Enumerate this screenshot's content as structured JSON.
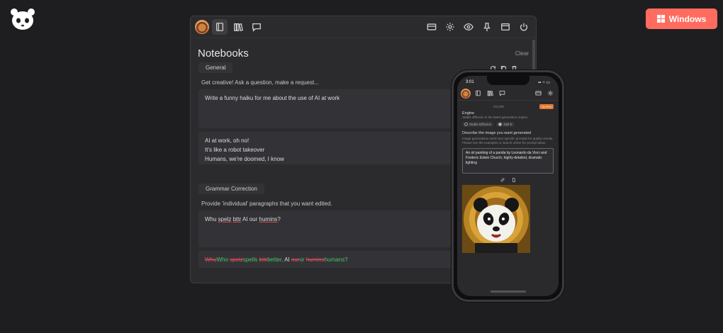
{
  "site": {
    "download_button_label": "Windows"
  },
  "app": {
    "notebooks_title": "Notebooks",
    "clear_label": "Clear",
    "cells": [
      {
        "tab": "General",
        "prompt_hint": "Get creative! Ask a question, make a request...",
        "input": "Write a funny haiku for me about the use of AI at work",
        "output_lines": [
          "AI at work, oh no!",
          "It's like a robot takeover",
          "Humans, we're doomed, I know"
        ]
      },
      {
        "tab": "Grammar Correction",
        "prompt_hint": "Provide 'individual' paragraphs that you want edited.",
        "input_parts": [
          "Whu ",
          "spelz",
          " ",
          "bttr",
          " AI our ",
          "humins",
          "?"
        ],
        "correction": {
          "del1": "Whu",
          "ins1": "Who",
          "sp1": " ",
          "del2": "spelz",
          "ins2": "spells",
          "sp2": " ",
          "del3": "bttr",
          "ins3": "better,",
          "mid": " AI ",
          "del4": "our",
          "ins4": "or",
          "sp4": " ",
          "del5": "humins",
          "ins5": "humans?"
        }
      }
    ]
  },
  "phone": {
    "time": "3:01",
    "counter": "0/4,000",
    "pro_badge": "Go Pro!",
    "engine_label": "Engine",
    "engine_desc": "Stable diffusion is the latest generation engine.",
    "engine_options": [
      "Stable Diffusion",
      "Dall-E"
    ],
    "describe_label": "Describe the image you want generated",
    "describe_help": "Image generations need very specific prompts for quality results. Please see the examples or search online for prompt ideas.",
    "prompt_text": "An oil painting of a panda by Leonardo da Vinci and Frederic Edwin Church, highly-detailed, dramatic lighting"
  }
}
